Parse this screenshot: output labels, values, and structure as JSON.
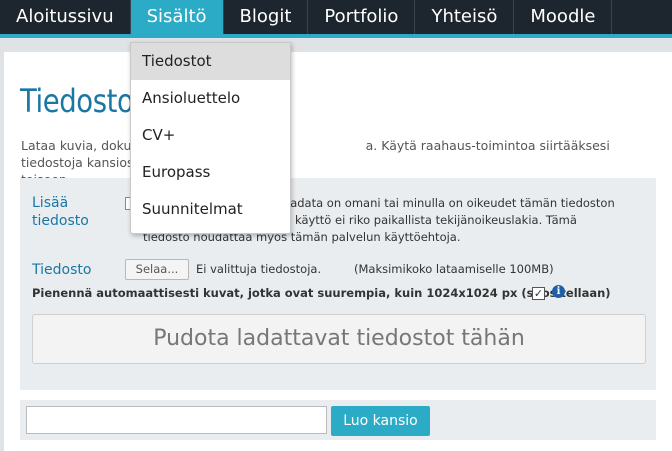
{
  "nav": {
    "items": [
      {
        "label": "Aloitussivu"
      },
      {
        "label": "Sisältö"
      },
      {
        "label": "Blogit"
      },
      {
        "label": "Portfolio"
      },
      {
        "label": "Yhteisö"
      },
      {
        "label": "Moodle"
      }
    ],
    "active_index": 1
  },
  "dropdown": {
    "items": [
      {
        "label": "Tiedostot"
      },
      {
        "label": "Ansioluettelo"
      },
      {
        "label": "CV+"
      },
      {
        "label": "Europass"
      },
      {
        "label": "Suunnitelmat"
      }
    ],
    "highlighted_index": 0
  },
  "page": {
    "title": "Tiedostot",
    "intro": "Lataa kuvia, dokum… Käytä raahaus-toimintoa siirtääksesi tiedostoja kansiosta toiseen.",
    "intro_line1": "Lataa kuvia, dokum",
    "intro_line1_end": "a. Käytä raahaus-toimintoa siirtääksesi tiedostoja kansiosta",
    "intro_line2": "toiseen."
  },
  "upload": {
    "add_file_label_1": "Lisää",
    "add_file_label_2": "tiedosto",
    "terms_line1": "ladata on omani tai minulla on oikeudet tämän tiedoston",
    "terms_line2": "on käyttö ei riko paikallista tekijänoikeuslakia. Tämä",
    "terms_line3": "tiedosto noudattaa myös tämän palvelun käyttöehtoja.",
    "file_label": "Tiedosto",
    "browse_label": "Selaa...",
    "no_file_text": "Ei valittuja tiedostoja.",
    "max_size_text": "(Maksimikoko lataamiselle 100MB)",
    "resize_text": "Pienennä automaattisesti kuvat, jotka ovat suurempia, kuin 1024x1024 px (suositellaan)",
    "resize_checked": true,
    "dropzone_text": "Pudota ladattavat tiedostot tähän"
  },
  "folder": {
    "input_value": "",
    "create_label": "Luo kansio"
  },
  "colors": {
    "nav_bg": "#1d262e",
    "accent": "#2cabc7",
    "title": "#1877a3"
  }
}
